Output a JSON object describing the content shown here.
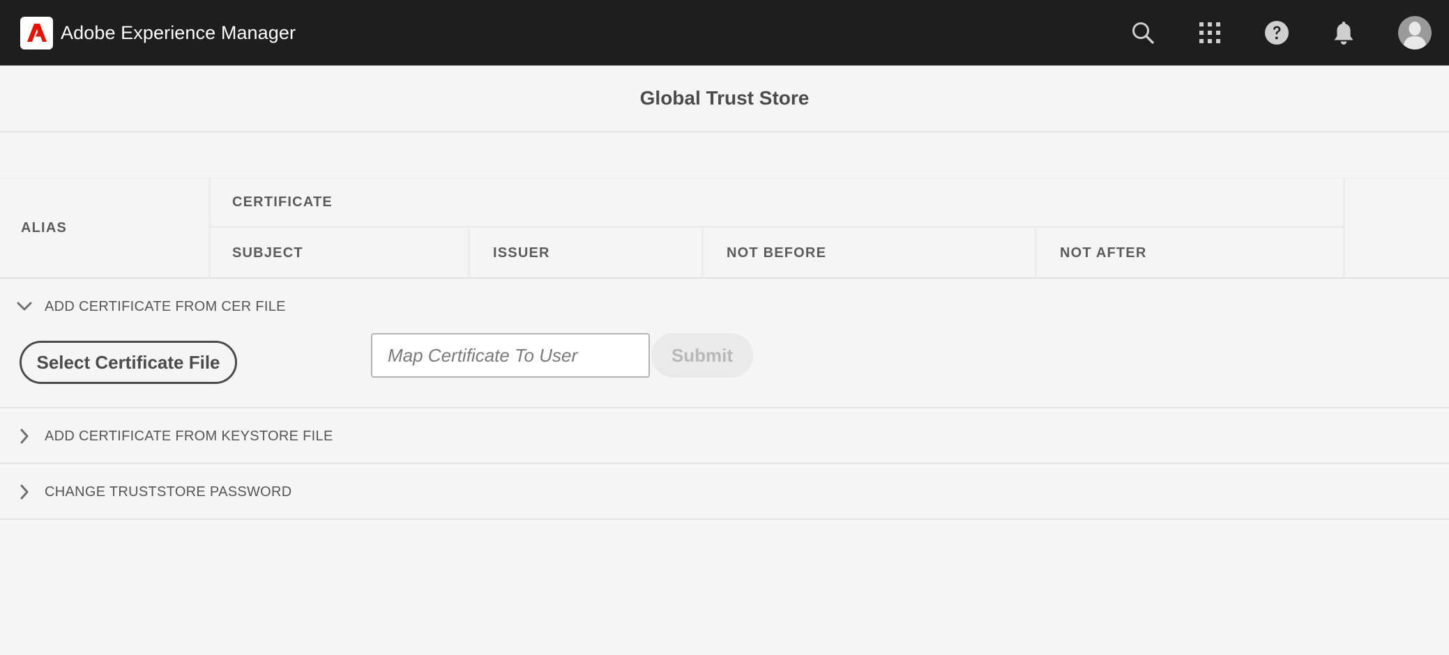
{
  "app": {
    "name": "Adobe Experience Manager",
    "brand_color": "#eb1000"
  },
  "header": {
    "icons": [
      "search-icon",
      "apps-grid-icon",
      "help-icon",
      "bell-icon",
      "avatar"
    ]
  },
  "page": {
    "title": "Global Trust Store"
  },
  "table": {
    "columns": {
      "alias": "ALIAS",
      "certificate": "CERTIFICATE",
      "subject": "SUBJECT",
      "issuer": "ISSUER",
      "not_before": "NOT BEFORE",
      "not_after": "NOT AFTER"
    },
    "rows": []
  },
  "accordion": {
    "cer": {
      "label": "ADD CERTIFICATE FROM CER FILE",
      "expanded": true,
      "select_button": "Select Certificate File",
      "map_placeholder": "Map Certificate To User",
      "map_value": "",
      "submit_button": "Submit"
    },
    "keystore": {
      "label": "ADD CERTIFICATE FROM KEYSTORE FILE",
      "expanded": false
    },
    "password": {
      "label": "CHANGE TRUSTSTORE PASSWORD",
      "expanded": false
    }
  }
}
